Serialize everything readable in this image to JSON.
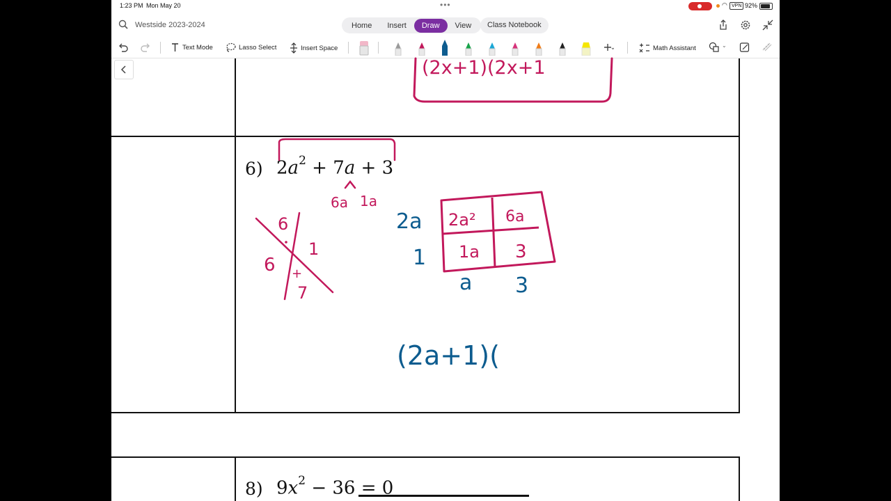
{
  "status_bar": {
    "time": "1:23 PM",
    "date": "Mon May 20",
    "vpn": "VPN",
    "battery": "92%"
  },
  "title_bar": {
    "notebook_title": "Westside 2023-2024",
    "tabs": [
      {
        "label": "Home",
        "active": false
      },
      {
        "label": "Insert",
        "active": false
      },
      {
        "label": "Draw",
        "active": true
      },
      {
        "label": "View",
        "active": false
      }
    ],
    "class_notebook": "Class Notebook"
  },
  "ribbon": {
    "text_mode": "Text Mode",
    "lasso_select": "Lasso Select",
    "insert_space": "Insert Space",
    "math_assistant": "Math Assistant",
    "pens": [
      {
        "name": "pencil-gray",
        "color": "#9a9a9a"
      },
      {
        "name": "pen-magenta",
        "color": "#c2185b"
      },
      {
        "name": "pen-blue-selected",
        "color": "#0d5c8f"
      },
      {
        "name": "pen-green",
        "color": "#18a34a"
      },
      {
        "name": "pen-cyan",
        "color": "#1aa7d6"
      },
      {
        "name": "pen-pink",
        "color": "#d6337a"
      },
      {
        "name": "pen-orange",
        "color": "#f07c17"
      },
      {
        "name": "pen-black",
        "color": "#222222"
      },
      {
        "name": "highlighter-yellow",
        "color": "#f5e600"
      }
    ]
  },
  "page": {
    "top_ink_text": "(2x+1)(2x+1",
    "problem6": {
      "number": "6)",
      "coef": "2",
      "var1": "a",
      "exp": "2",
      "middle": "+ 7",
      "var2": "a",
      "tail": "+ 3"
    },
    "handwriting": {
      "split_left": "6a",
      "split_right": "1a",
      "x_top": "6",
      "x_left": "6",
      "x_right": "1",
      "x_bottom": "7",
      "box_row1_label": "2a",
      "box_row2_label": "1",
      "cell_11": "2a²",
      "cell_12": "6a",
      "cell_21": "1a",
      "cell_22": "3",
      "col1_label": "a",
      "col2_label": "3",
      "answer": "(2a+1)("
    },
    "problem8": {
      "number": "8)",
      "coef": "9",
      "var": "x",
      "exp": "2",
      "rest": "− 36 = 0"
    }
  },
  "colors": {
    "accent_purple": "#7b2ea1",
    "ink_magenta": "#c2185b",
    "ink_blue": "#0d5c8f"
  }
}
